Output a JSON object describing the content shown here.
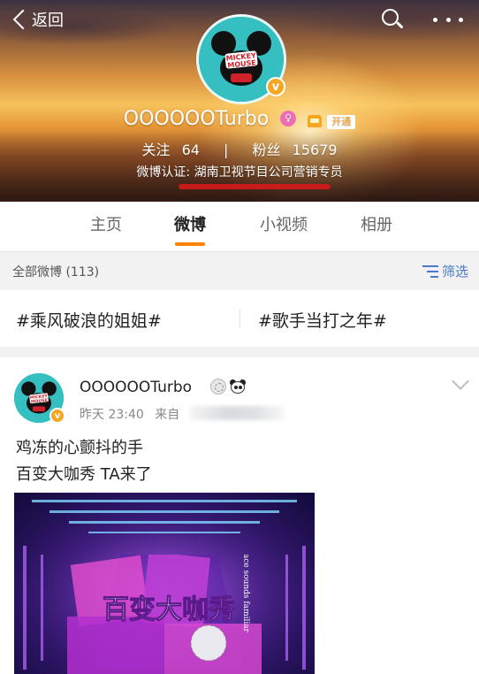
{
  "nav": {
    "back_label": "返回"
  },
  "profile": {
    "name": "OOOOOOTurbo",
    "gender_symbol": "♀",
    "vip_label": "开通",
    "following_label": "关注",
    "following_count": "64",
    "followers_label": "粉丝",
    "followers_count": "15679",
    "verification": "微博认证: 湖南卫视节目公司营销专员",
    "verified_badge": "v",
    "avatar_text_1": "MICKEY",
    "avatar_text_2": "MOUSE"
  },
  "tabs": [
    {
      "label": "主页",
      "active": false
    },
    {
      "label": "微博",
      "active": true
    },
    {
      "label": "小视频",
      "active": false
    },
    {
      "label": "相册",
      "active": false
    }
  ],
  "filter": {
    "all_label": "全部微博 (113)",
    "filter_label": "筛选"
  },
  "topics": [
    {
      "label": "#乘风破浪的姐姐#"
    },
    {
      "label": "#歌手当打之年#"
    }
  ],
  "post": {
    "author": "OOOOOOTurbo",
    "time": "昨天 23:40",
    "source_prefix": "来自",
    "text_line1": "鸡冻的心颤抖的手",
    "text_line2": "百变大咖秀 TA来了",
    "image_title_text": "百变大咖秀",
    "image_side_text": "Your face sounds familiar"
  },
  "colors": {
    "accent_orange": "#ff8200",
    "link_blue": "#4a79c9",
    "verified_badge": "#f5a623",
    "avatar_teal": "#35bfc0"
  }
}
